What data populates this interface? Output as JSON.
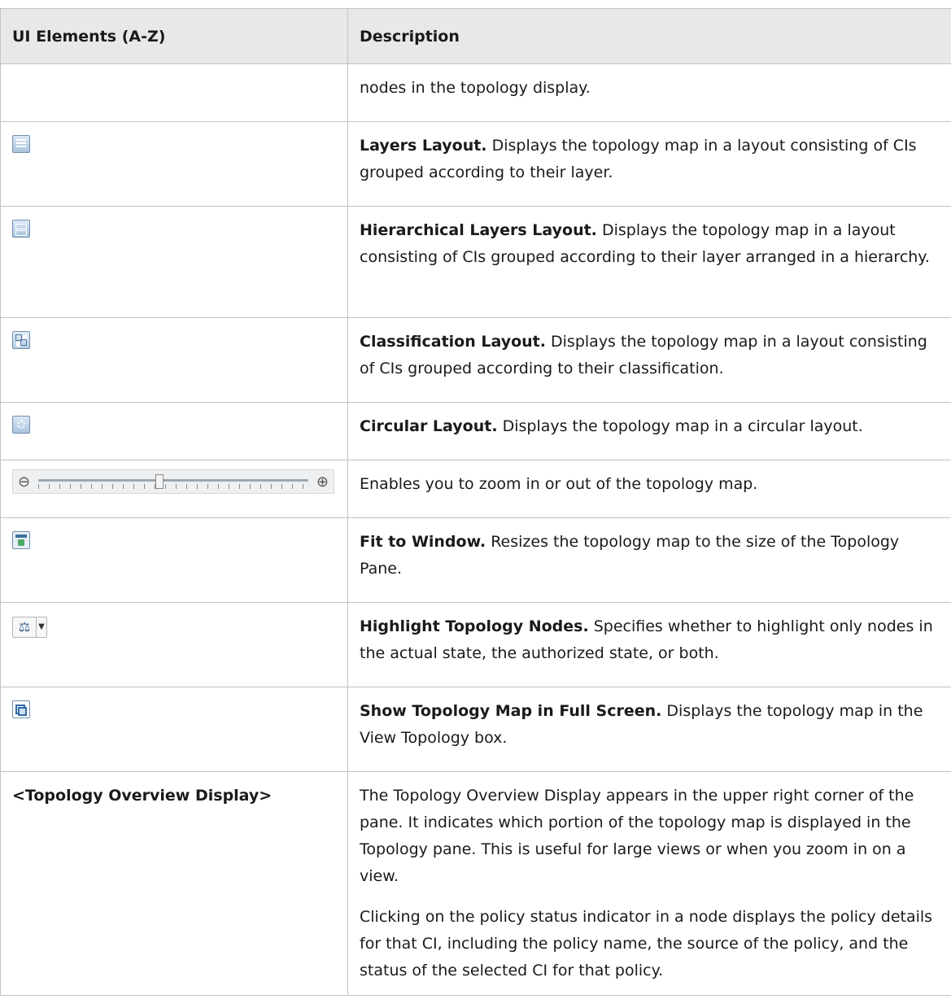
{
  "header": {
    "col1": "UI Elements (A-Z)",
    "col2": "Description"
  },
  "rows": [
    {
      "desc": "nodes in the topology display."
    },
    {
      "title": "Layers Layout.",
      "desc": " Displays the topology map in a layout consisting of CIs grouped according to their layer."
    },
    {
      "title": "Hierarchical Layers Layout.",
      "desc": " Displays the topology map in a layout consisting of CIs grouped according to their layer arranged in a hierarchy."
    },
    {
      "title": "Classification Layout.",
      "desc": " Displays the topology map in a layout consisting of CIs grouped according to their classification."
    },
    {
      "title": "Circular Layout.",
      "desc": " Displays the topology map in a circular layout."
    },
    {
      "desc": "Enables you to zoom in or out of the topology map."
    },
    {
      "title": "Fit to Window.",
      "desc": " Resizes the topology map to the size of the Topology Pane."
    },
    {
      "title": "Highlight Topology Nodes.",
      "desc": " Specifies whether to highlight only nodes in the actual state, the authorized state, or both."
    },
    {
      "title": "Show Topology Map in Full Screen.",
      "desc": " Displays the topology map in the View Topology box."
    },
    {
      "element": "<Topology Overview Display>",
      "p1": "The Topology Overview Display appears in the upper right corner of the pane. It indicates which portion of the topology map is displayed in the Topology pane. This is useful for large views or when you zoom in on a view.",
      "p2": "Clicking on the policy status indicator in a node displays the policy details for that CI, including the policy name, the source of the policy, and the status of the selected CI for that policy."
    }
  ],
  "zoom_level": 0.45,
  "icons": {
    "row1": "layers-layout-icon",
    "row2": "hierarchical-layers-layout-icon",
    "row3": "classification-layout-icon",
    "row4": "circular-layout-icon",
    "row5": "zoom-slider",
    "row6": "fit-to-window-icon",
    "row7": "highlight-topology-nodes-icon",
    "row8": "full-screen-icon"
  }
}
